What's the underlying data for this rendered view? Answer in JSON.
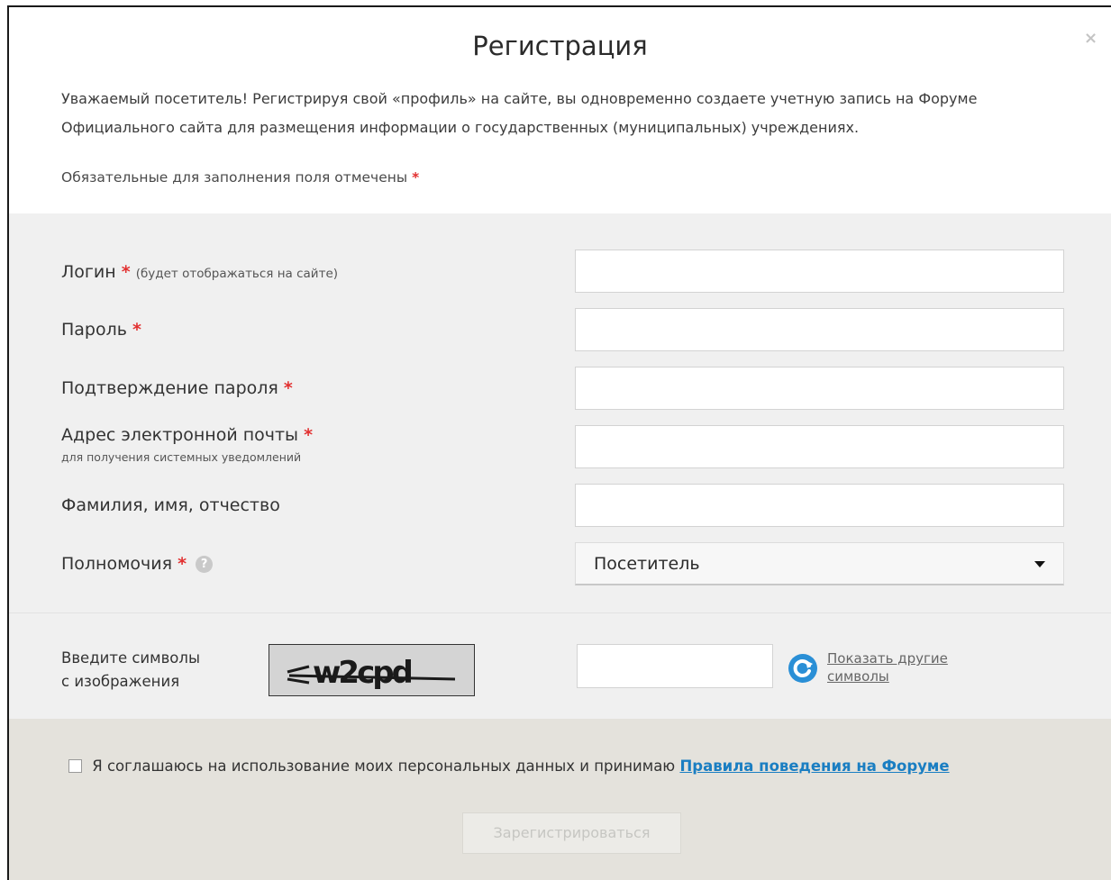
{
  "dialog": {
    "title": "Регистрация",
    "close_label": "×",
    "intro": "Уважаемый посетитель! Регистрируя свой «профиль» на сайте, вы одновременно создаете учетную запись на Форуме Официального сайта для размещения информации о государственных (муниципальных) учреждениях.",
    "required_note": "Обязательные для заполнения поля отмечены",
    "required_mark": "*"
  },
  "form": {
    "login": {
      "label": "Логин",
      "hint": "(будет отображаться на сайте)",
      "value": ""
    },
    "password": {
      "label": "Пароль",
      "value": ""
    },
    "password_confirm": {
      "label": "Подтверждение пароля",
      "value": ""
    },
    "email": {
      "label": "Адрес электронной почты",
      "sublabel": "для получения системных уведомлений",
      "value": ""
    },
    "fullname": {
      "label": "Фамилия, имя, отчество",
      "value": ""
    },
    "role": {
      "label": "Полномочия",
      "help_icon": "?",
      "selected": "Посетитель"
    }
  },
  "captcha": {
    "label_line1": "Введите символы",
    "label_line2": "с изображения",
    "image_text": "w2cpd",
    "value": "",
    "refresh_line1": "Показать другие",
    "refresh_line2": "символы"
  },
  "footer": {
    "agree_text": "Я соглашаюсь на использование моих персональных данных и принимаю",
    "rules_link": "Правила поведения на Форуме",
    "checked": false,
    "submit_label": "Зарегистрироваться"
  },
  "colors": {
    "required": "#e23030",
    "link": "#1a7ec2",
    "form_bg": "#f0f0f0",
    "footer_bg": "#e4e2dc"
  }
}
